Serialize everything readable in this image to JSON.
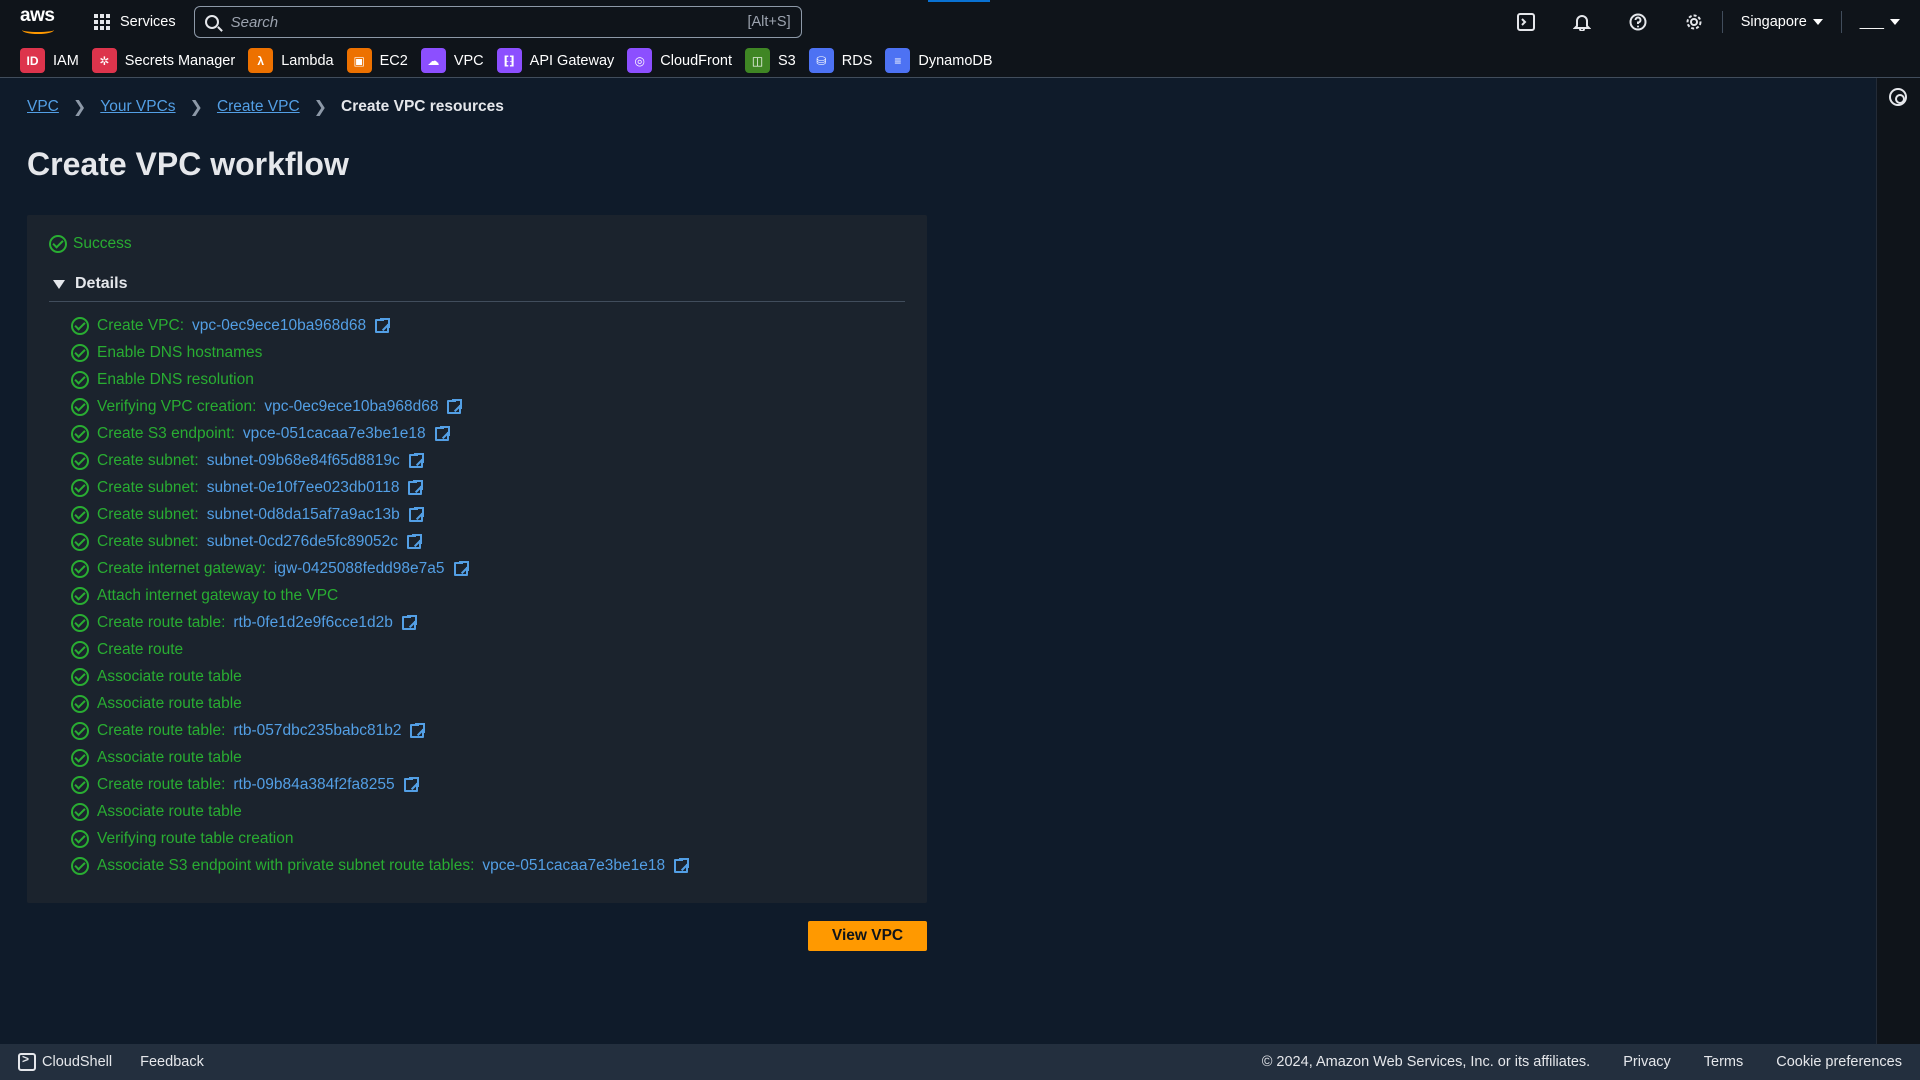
{
  "topnav": {
    "services_label": "Services",
    "search_placeholder": "Search",
    "search_shortcut": "[Alt+S]",
    "region": "Singapore",
    "account": "___"
  },
  "favorites": [
    {
      "label": "IAM",
      "icon": "iam-icon",
      "color": "#dd344c"
    },
    {
      "label": "Secrets Manager",
      "icon": "secrets-manager-icon",
      "color": "#dd344c"
    },
    {
      "label": "Lambda",
      "icon": "lambda-icon",
      "color": "#ed7100"
    },
    {
      "label": "EC2",
      "icon": "ec2-icon",
      "color": "#ed7100"
    },
    {
      "label": "VPC",
      "icon": "vpc-icon",
      "color": "#8c4fff"
    },
    {
      "label": "API Gateway",
      "icon": "api-gateway-icon",
      "color": "#8c4fff"
    },
    {
      "label": "CloudFront",
      "icon": "cloudfront-icon",
      "color": "#8c4fff"
    },
    {
      "label": "S3",
      "icon": "s3-icon",
      "color": "#3f8624"
    },
    {
      "label": "RDS",
      "icon": "rds-icon",
      "color": "#4d72f3"
    },
    {
      "label": "DynamoDB",
      "icon": "dynamodb-icon",
      "color": "#4d72f3"
    }
  ],
  "breadcrumb": {
    "items": [
      "VPC",
      "Your VPCs",
      "Create VPC"
    ],
    "current": "Create VPC resources"
  },
  "page_title": "Create VPC workflow",
  "status": "Success",
  "details_label": "Details",
  "steps": [
    {
      "text": "Create VPC:",
      "link": "vpc-0ec9ece10ba968d68"
    },
    {
      "text": "Enable DNS hostnames",
      "link": ""
    },
    {
      "text": "Enable DNS resolution",
      "link": ""
    },
    {
      "text": "Verifying VPC creation:",
      "link": "vpc-0ec9ece10ba968d68"
    },
    {
      "text": "Create S3 endpoint:",
      "link": "vpce-051cacaa7e3be1e18"
    },
    {
      "text": "Create subnet:",
      "link": "subnet-09b68e84f65d8819c"
    },
    {
      "text": "Create subnet:",
      "link": "subnet-0e10f7ee023db0118"
    },
    {
      "text": "Create subnet:",
      "link": "subnet-0d8da15af7a9ac13b"
    },
    {
      "text": "Create subnet:",
      "link": "subnet-0cd276de5fc89052c"
    },
    {
      "text": "Create internet gateway:",
      "link": "igw-0425088fedd98e7a5"
    },
    {
      "text": "Attach internet gateway to the VPC",
      "link": ""
    },
    {
      "text": "Create route table:",
      "link": "rtb-0fe1d2e9f6cce1d2b"
    },
    {
      "text": "Create route",
      "link": ""
    },
    {
      "text": "Associate route table",
      "link": ""
    },
    {
      "text": "Associate route table",
      "link": ""
    },
    {
      "text": "Create route table:",
      "link": "rtb-057dbc235babc81b2"
    },
    {
      "text": "Associate route table",
      "link": ""
    },
    {
      "text": "Create route table:",
      "link": "rtb-09b84a384f2fa8255"
    },
    {
      "text": "Associate route table",
      "link": ""
    },
    {
      "text": "Verifying route table creation",
      "link": ""
    },
    {
      "text": "Associate S3 endpoint with private subnet route tables:",
      "link": "vpce-051cacaa7e3be1e18"
    }
  ],
  "view_button": "View VPC",
  "footer": {
    "cloudshell": "CloudShell",
    "feedback": "Feedback",
    "copyright": "© 2024, Amazon Web Services, Inc. or its affiliates.",
    "privacy": "Privacy",
    "terms": "Terms",
    "cookies": "Cookie preferences"
  },
  "colors": {
    "success": "#29ad32",
    "link": "#539fe5",
    "primary_button": "#ff9900",
    "background": "#0f1b2a"
  }
}
